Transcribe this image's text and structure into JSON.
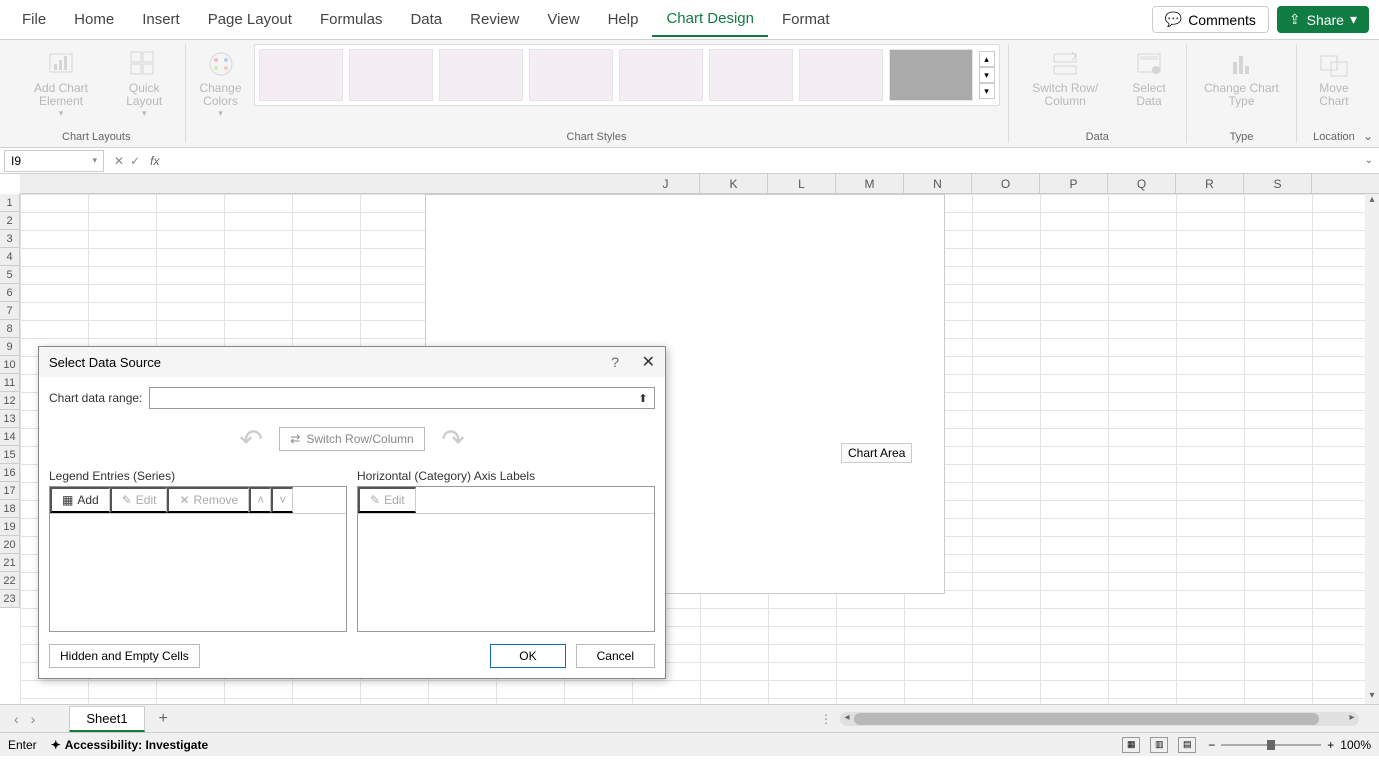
{
  "ribbon": {
    "tabs": [
      "File",
      "Home",
      "Insert",
      "Page Layout",
      "Formulas",
      "Data",
      "Review",
      "View",
      "Help",
      "Chart Design",
      "Format"
    ],
    "active_tab": "Chart Design",
    "comments": "Comments",
    "share": "Share",
    "groups": {
      "chart_layouts": {
        "label": "Chart Layouts",
        "add_element": "Add Chart Element",
        "quick_layout": "Quick Layout"
      },
      "chart_styles": {
        "label": "Chart Styles",
        "change_colors": "Change Colors"
      },
      "data": {
        "label": "Data",
        "switch": "Switch Row/ Column",
        "select": "Select Data"
      },
      "type": {
        "label": "Type",
        "change_type": "Change Chart Type"
      },
      "location": {
        "label": "Location",
        "move": "Move Chart"
      }
    }
  },
  "formula_bar": {
    "name_box": "I9",
    "value": ""
  },
  "grid": {
    "visible_columns": [
      "J",
      "K",
      "L",
      "M",
      "N",
      "O",
      "P",
      "Q",
      "R",
      "S"
    ],
    "visible_rows": [
      "1",
      "2",
      "3",
      "4",
      "5",
      "6",
      "7",
      "8",
      "9",
      "10",
      "11",
      "12",
      "13",
      "14",
      "15",
      "16",
      "17",
      "18",
      "19",
      "20",
      "21",
      "22",
      "23"
    ]
  },
  "chart": {
    "tooltip": "Chart Area"
  },
  "dialog": {
    "title": "Select Data Source",
    "range_label": "Chart data range:",
    "range_value": "",
    "switch_btn": "Switch Row/Column",
    "legend_label": "Legend Entries (Series)",
    "axis_label": "Horizontal (Category) Axis Labels",
    "btn_add": "Add",
    "btn_edit": "Edit",
    "btn_remove": "Remove",
    "hidden": "Hidden and Empty Cells",
    "ok": "OK",
    "cancel": "Cancel"
  },
  "sheets": {
    "active": "Sheet1"
  },
  "status": {
    "mode": "Enter",
    "accessibility": "Accessibility: Investigate",
    "zoom": "100%"
  }
}
